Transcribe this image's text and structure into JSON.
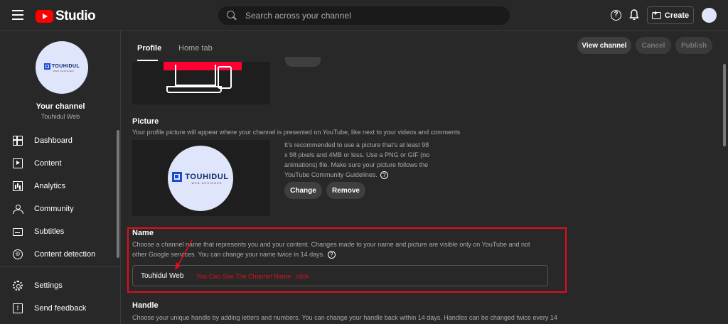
{
  "topbar": {
    "logo_text": "Studio",
    "search_placeholder": "Search across your channel",
    "help_glyph": "?",
    "create_label": "Create"
  },
  "sidebar": {
    "your_channel": "Your channel",
    "channel_name": "Touhidul Web",
    "avatar_logo_text": "TOUHIDUL",
    "avatar_logo_sub": "WEB DESIGNER",
    "items": [
      {
        "label": "Dashboard",
        "icon": "dashboard-icon"
      },
      {
        "label": "Content",
        "icon": "content-icon"
      },
      {
        "label": "Analytics",
        "icon": "analytics-icon"
      },
      {
        "label": "Community",
        "icon": "community-icon"
      },
      {
        "label": "Subtitles",
        "icon": "subtitles-icon"
      },
      {
        "label": "Content detection",
        "icon": "content-detection-icon"
      },
      {
        "label": "Settings",
        "icon": "settings-icon"
      },
      {
        "label": "Send feedback",
        "icon": "feedback-icon"
      }
    ]
  },
  "tabs": [
    {
      "label": "Profile",
      "active": true
    },
    {
      "label": "Home tab",
      "active": false
    }
  ],
  "actions": {
    "view_channel": "View channel",
    "cancel": "Cancel",
    "publish": "Publish"
  },
  "picture": {
    "title": "Picture",
    "desc": "Your profile picture will appear where your channel is presented on YouTube, like next to your videos and comments",
    "info": "It’s recommended to use a picture that’s at least 98 x 98 pixels and 4MB or less. Use a PNG or GIF (no animations) file. Make sure your picture follows the YouTube Community Guidelines.",
    "logo_text": "TOUHIDUL",
    "logo_sub": "WEB DESIGNER",
    "change_label": "Change",
    "remove_label": "Remove"
  },
  "name": {
    "title": "Name",
    "desc": "Choose a channel name that represents you and your content. Changes made to your name and picture are visible only on YouTube and not other Google services. You can change your name twice in 14 days.",
    "value": "Touhidul Web",
    "annotation": "You Can See The Channel Name . click"
  },
  "handle": {
    "title": "Handle",
    "desc": "Choose your unique handle by adding letters and numbers. You can change your handle back within 14 days. Handles can be changed twice every 14"
  },
  "colors": {
    "accent_red": "#ff0000",
    "annotation_red": "#e10f1a",
    "background": "#282828"
  }
}
